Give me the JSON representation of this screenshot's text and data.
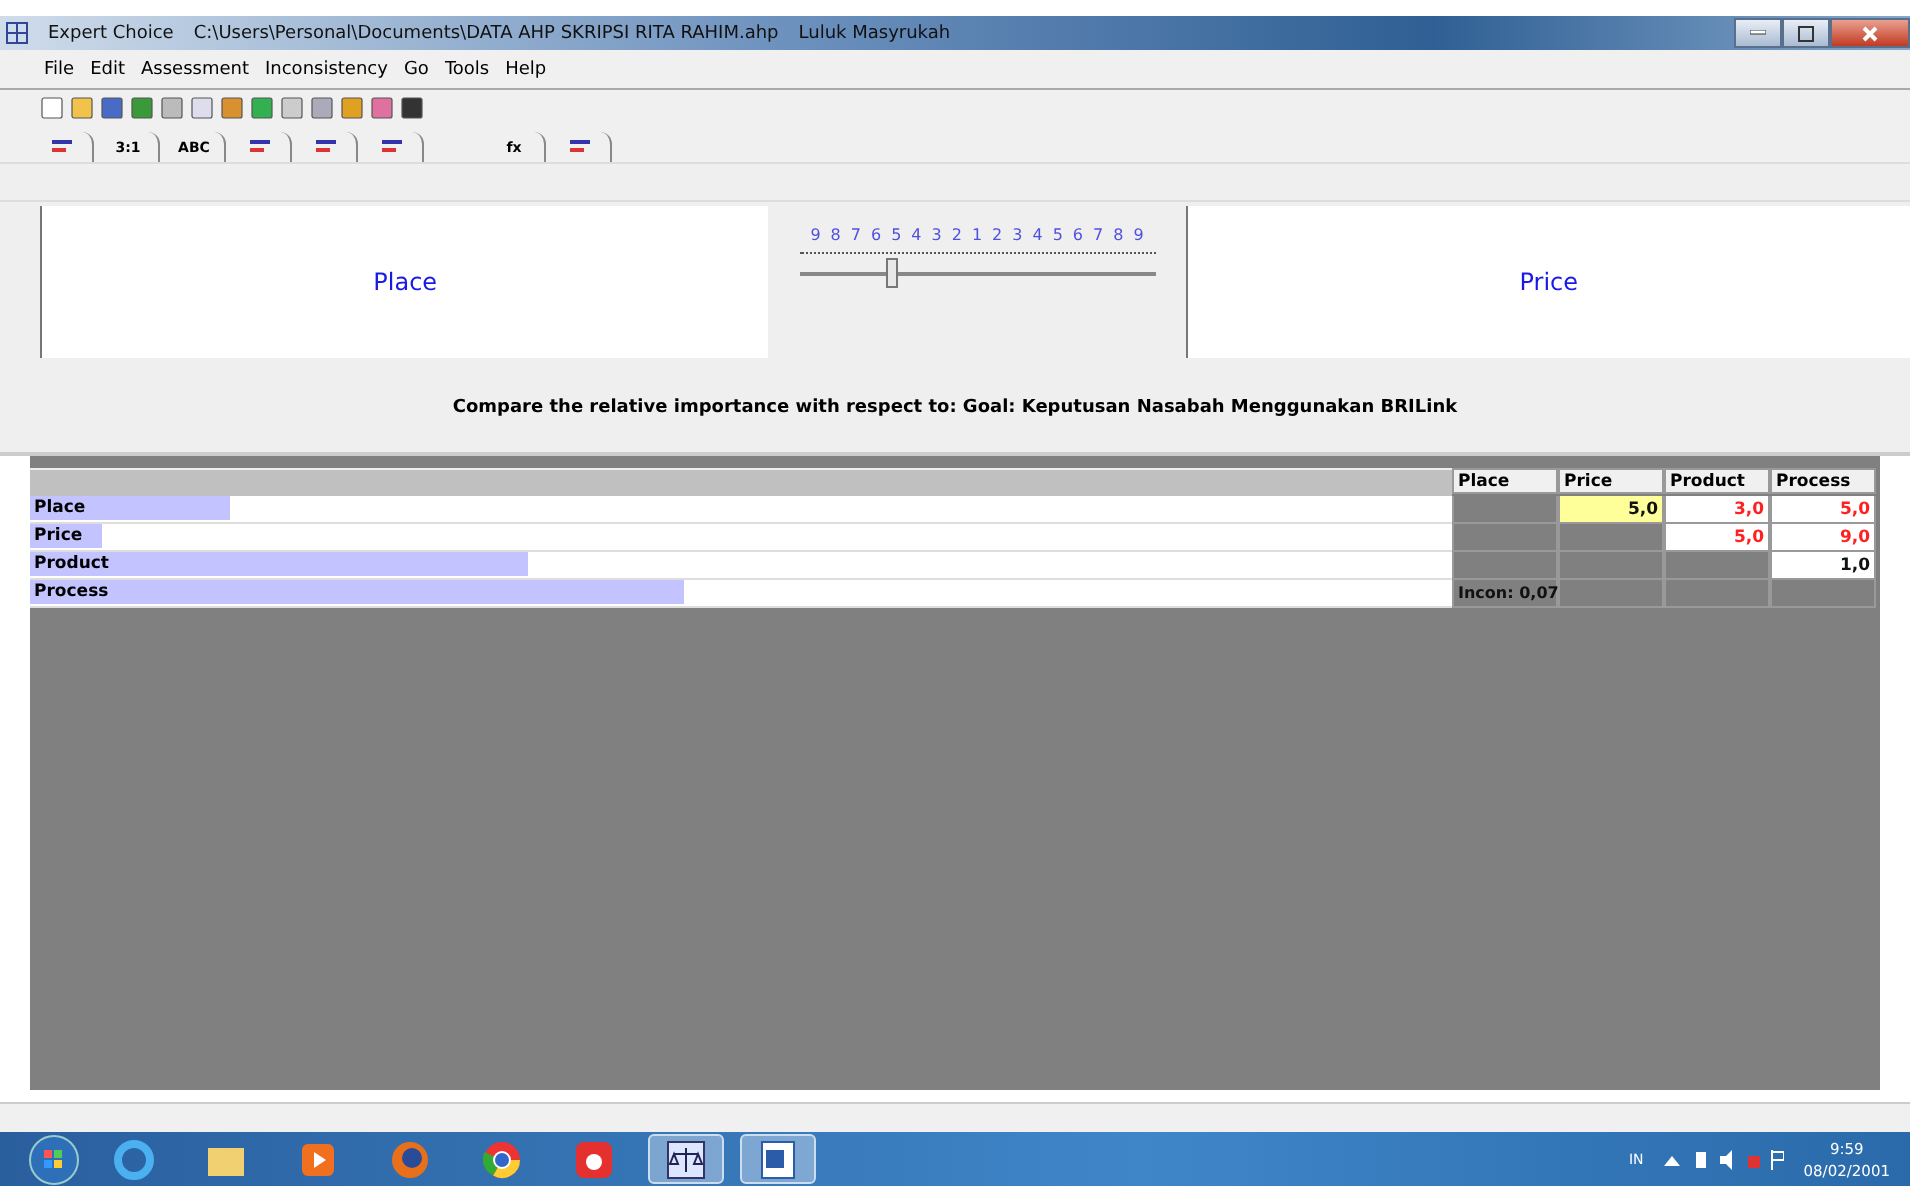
{
  "window": {
    "title": "Expert Choice",
    "path": "C:\\Users\\Personal\\Documents\\DATA AHP SKRIPSI RITA RAHIM.ahp",
    "user": "Luluk Masyrukah"
  },
  "menu": [
    "File",
    "Edit",
    "Assessment",
    "Inconsistency",
    "Go",
    "Tools",
    "Help"
  ],
  "mode_tabs": [
    {
      "kind": "icon"
    },
    {
      "kind": "text",
      "text": "3:1"
    },
    {
      "kind": "text",
      "text": "ABC"
    },
    {
      "kind": "icon"
    },
    {
      "kind": "icon"
    },
    {
      "kind": "icon"
    },
    {
      "kind": "text",
      "text": "fx"
    },
    {
      "kind": "icon"
    }
  ],
  "compare": {
    "left": "Place",
    "right": "Price",
    "scale": [
      "9",
      "8",
      "7",
      "6",
      "5",
      "4",
      "3",
      "2",
      "1",
      "2",
      "3",
      "4",
      "5",
      "6",
      "7",
      "8",
      "9"
    ],
    "level": 0.26
  },
  "prompt": "Compare the relative importance with respect to: Goal: Keputusan Nasabah Menggunakan BRILink",
  "matrix": {
    "columns": [
      "Place",
      "Price",
      "Product",
      "Process"
    ],
    "rows": [
      {
        "name": "Place",
        "level": 0.14,
        "cells": [
          {
            "kind": "blank"
          },
          {
            "kind": "value",
            "text": "5,0",
            "inverted": false,
            "selected": true
          },
          {
            "kind": "value",
            "text": "3,0",
            "inverted": true,
            "selected": false
          },
          {
            "kind": "value",
            "text": "5,0",
            "inverted": true,
            "selected": false
          }
        ]
      },
      {
        "name": "Price",
        "level": 0.05,
        "cells": [
          {
            "kind": "blank"
          },
          {
            "kind": "blank"
          },
          {
            "kind": "value",
            "text": "5,0",
            "inverted": true,
            "selected": false
          },
          {
            "kind": "value",
            "text": "9,0",
            "inverted": true,
            "selected": false
          }
        ]
      },
      {
        "name": "Product",
        "level": 0.35,
        "cells": [
          {
            "kind": "blank"
          },
          {
            "kind": "blank"
          },
          {
            "kind": "blank"
          },
          {
            "kind": "value",
            "text": "1,0",
            "inverted": false,
            "selected": false
          }
        ]
      },
      {
        "name": "Process",
        "level": 0.46,
        "cells": [
          {
            "kind": "incon",
            "text": "Incon: 0,07"
          },
          {
            "kind": "blank"
          },
          {
            "kind": "blank"
          },
          {
            "kind": "blank"
          }
        ]
      }
    ]
  },
  "taskbar": {
    "apps": [
      {
        "kind": "ie",
        "active": false
      },
      {
        "kind": "folder",
        "active": false
      },
      {
        "kind": "media",
        "active": false
      },
      {
        "kind": "firefox",
        "active": false
      },
      {
        "kind": "chrome",
        "active": false
      },
      {
        "kind": "camera",
        "active": false
      },
      {
        "kind": "scale",
        "active": true
      },
      {
        "kind": "word",
        "active": true
      }
    ],
    "language": "IN",
    "time": "9:59",
    "date": "08/02/2001"
  }
}
